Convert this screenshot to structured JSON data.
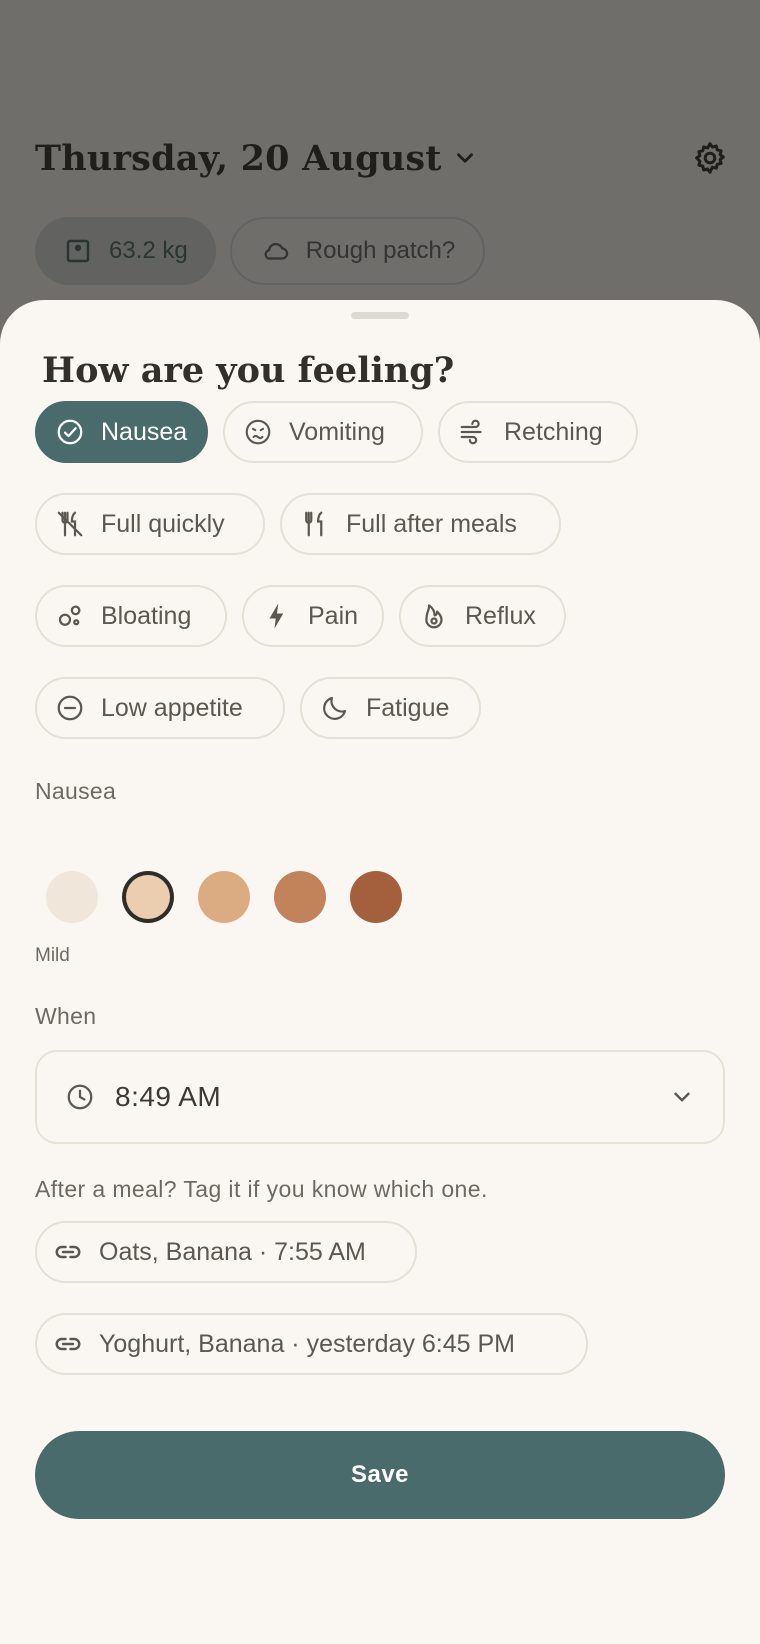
{
  "background": {
    "date_title": "Thursday, 20 August",
    "date_icon": "chevron-down-icon",
    "settings_icon": "gear-icon",
    "weight_chip": {
      "label": "63.2 kg",
      "icon": "scale-icon"
    },
    "rough_chip": {
      "label": "Rough patch?",
      "icon": "cloud-icon"
    }
  },
  "sheet": {
    "title": "How are you feeling?",
    "symptoms": [
      {
        "label": "Nausea",
        "icon": "check-circle-icon",
        "selected": true
      },
      {
        "label": "Vomiting",
        "icon": "sick-face-icon",
        "selected": false
      },
      {
        "label": "Retching",
        "icon": "wind-icon",
        "selected": false
      },
      {
        "label": "Full quickly",
        "icon": "utensils-crossed-icon",
        "selected": false
      },
      {
        "label": "Full after meals",
        "icon": "utensils-icon",
        "selected": false
      },
      {
        "label": "Bloating",
        "icon": "bubbles-icon",
        "selected": false
      },
      {
        "label": "Pain",
        "icon": "bolt-icon",
        "selected": false
      },
      {
        "label": "Reflux",
        "icon": "flame-icon",
        "selected": false
      },
      {
        "label": "Low appetite",
        "icon": "minus-circle-icon",
        "selected": false
      },
      {
        "label": "Fatigue",
        "icon": "moon-icon",
        "selected": false
      }
    ],
    "severity": {
      "label": "Nausea",
      "caption": "Mild",
      "selected_level": 2,
      "levels": 5,
      "colors": [
        "#f1e6da",
        "#ebcdb0",
        "#dbab82",
        "#c3835a",
        "#a4603c"
      ]
    },
    "when": {
      "label": "When",
      "time": "8:49 AM",
      "icon": "clock-icon",
      "dropdown_icon": "chevron-down-icon"
    },
    "meal_hint": "After a meal? Tag it if you know which one.",
    "meals": [
      {
        "label": "Oats, Banana · 7:55 AM",
        "icon": "link-icon"
      },
      {
        "label": "Yoghurt, Banana · yesterday 6:45 PM",
        "icon": "link-icon"
      }
    ],
    "save_label": "Save",
    "colors": {
      "accent": "#4a6b6b",
      "sheet_bg": "#faf7f2",
      "scrim": "#6f6e6a"
    }
  }
}
